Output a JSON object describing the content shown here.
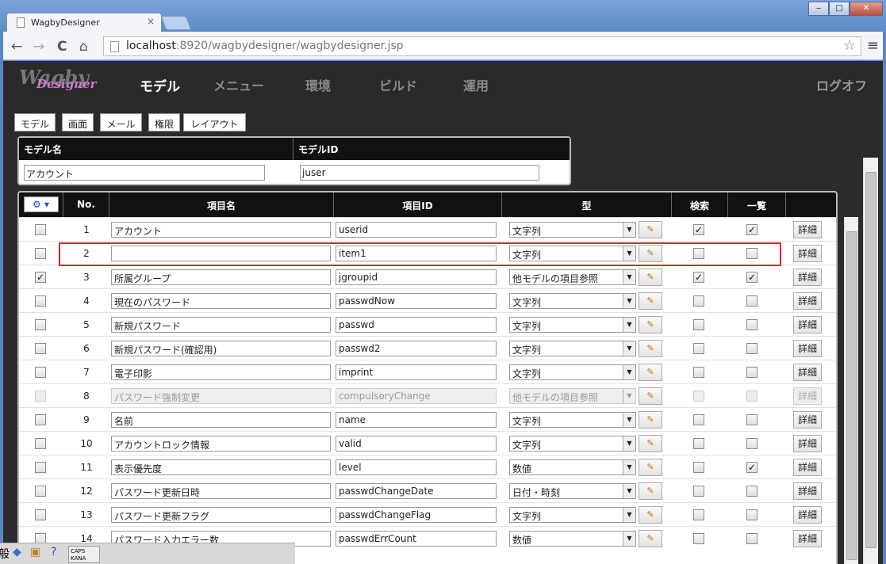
{
  "browser": {
    "tab_title": "WagbyDesigner",
    "tab_close": "×",
    "url_host": "localhost",
    "url_path": ":8920/wagbydesigner/wagbydesigner.jsp",
    "back": "←",
    "forward": "→",
    "reload": "C",
    "home": "⌂",
    "bookmark_star": "☆",
    "menu": "≡",
    "win_min": "‒",
    "win_max": "□",
    "win_close": "✕"
  },
  "app": {
    "logo": "Wagby",
    "logo_sub": "Designer",
    "menu": [
      "モデル",
      "メニュー",
      "環境",
      "ビルド",
      "運用"
    ],
    "logoff": "ログオフ",
    "subtabs": [
      "モデル",
      "画面",
      "メール",
      "権限",
      "レイアウト"
    ]
  },
  "model": {
    "name_label": "モデル名",
    "id_label": "モデルID",
    "name_value": "アカウント",
    "id_value": "juser"
  },
  "grid": {
    "headers": [
      "No.",
      "項目名",
      "項目ID",
      "型",
      "検索",
      "一覧"
    ],
    "tool_icon": "⚙",
    "detail_label": "詳細",
    "edit_icon": "✎",
    "check_mark": "✓",
    "rows": [
      {
        "sel": false,
        "no": "1",
        "name": "アカウント",
        "id": "userid",
        "type": "文字列",
        "search": true,
        "list": true,
        "disabled": false
      },
      {
        "sel": false,
        "no": "2",
        "name": "",
        "id": "item1",
        "type": "文字列",
        "search": false,
        "list": false,
        "disabled": false
      },
      {
        "sel": true,
        "no": "3",
        "name": "所属グループ",
        "id": "jgroupid",
        "type": "他モデルの項目参照",
        "search": true,
        "list": true,
        "disabled": false
      },
      {
        "sel": false,
        "no": "4",
        "name": "現在のパスワード",
        "id": "passwdNow",
        "type": "文字列",
        "search": false,
        "list": false,
        "disabled": false
      },
      {
        "sel": false,
        "no": "5",
        "name": "新規パスワード",
        "id": "passwd",
        "type": "文字列",
        "search": false,
        "list": false,
        "disabled": false
      },
      {
        "sel": false,
        "no": "6",
        "name": "新規パスワード(確認用)",
        "id": "passwd2",
        "type": "文字列",
        "search": false,
        "list": false,
        "disabled": false
      },
      {
        "sel": false,
        "no": "7",
        "name": "電子印影",
        "id": "imprint",
        "type": "文字列",
        "search": false,
        "list": false,
        "disabled": false
      },
      {
        "sel": false,
        "no": "8",
        "name": "パスワード強制変更",
        "id": "compulsoryChange",
        "type": "他モデルの項目参照",
        "search": false,
        "list": false,
        "disabled": true
      },
      {
        "sel": false,
        "no": "9",
        "name": "名前",
        "id": "name",
        "type": "文字列",
        "search": false,
        "list": false,
        "disabled": false
      },
      {
        "sel": false,
        "no": "10",
        "name": "アカウントロック情報",
        "id": "valid",
        "type": "文字列",
        "search": false,
        "list": false,
        "disabled": false
      },
      {
        "sel": false,
        "no": "11",
        "name": "表示優先度",
        "id": "level",
        "type": "数値",
        "search": false,
        "list": true,
        "disabled": false
      },
      {
        "sel": false,
        "no": "12",
        "name": "パスワード更新日時",
        "id": "passwdChangeDate",
        "type": "日付・時刻",
        "search": false,
        "list": false,
        "disabled": false
      },
      {
        "sel": false,
        "no": "13",
        "name": "パスワード更新フラグ",
        "id": "passwdChangeFlag",
        "type": "文字列",
        "search": false,
        "list": false,
        "disabled": false
      },
      {
        "sel": false,
        "no": "14",
        "name": "パスワード入力エラー数",
        "id": "passwdErrCount",
        "type": "数値",
        "search": false,
        "list": false,
        "disabled": false
      }
    ]
  },
  "taskbar": {
    "ime": "般",
    "caps": "CAPS",
    "kana": "KANA",
    "help": "?"
  }
}
